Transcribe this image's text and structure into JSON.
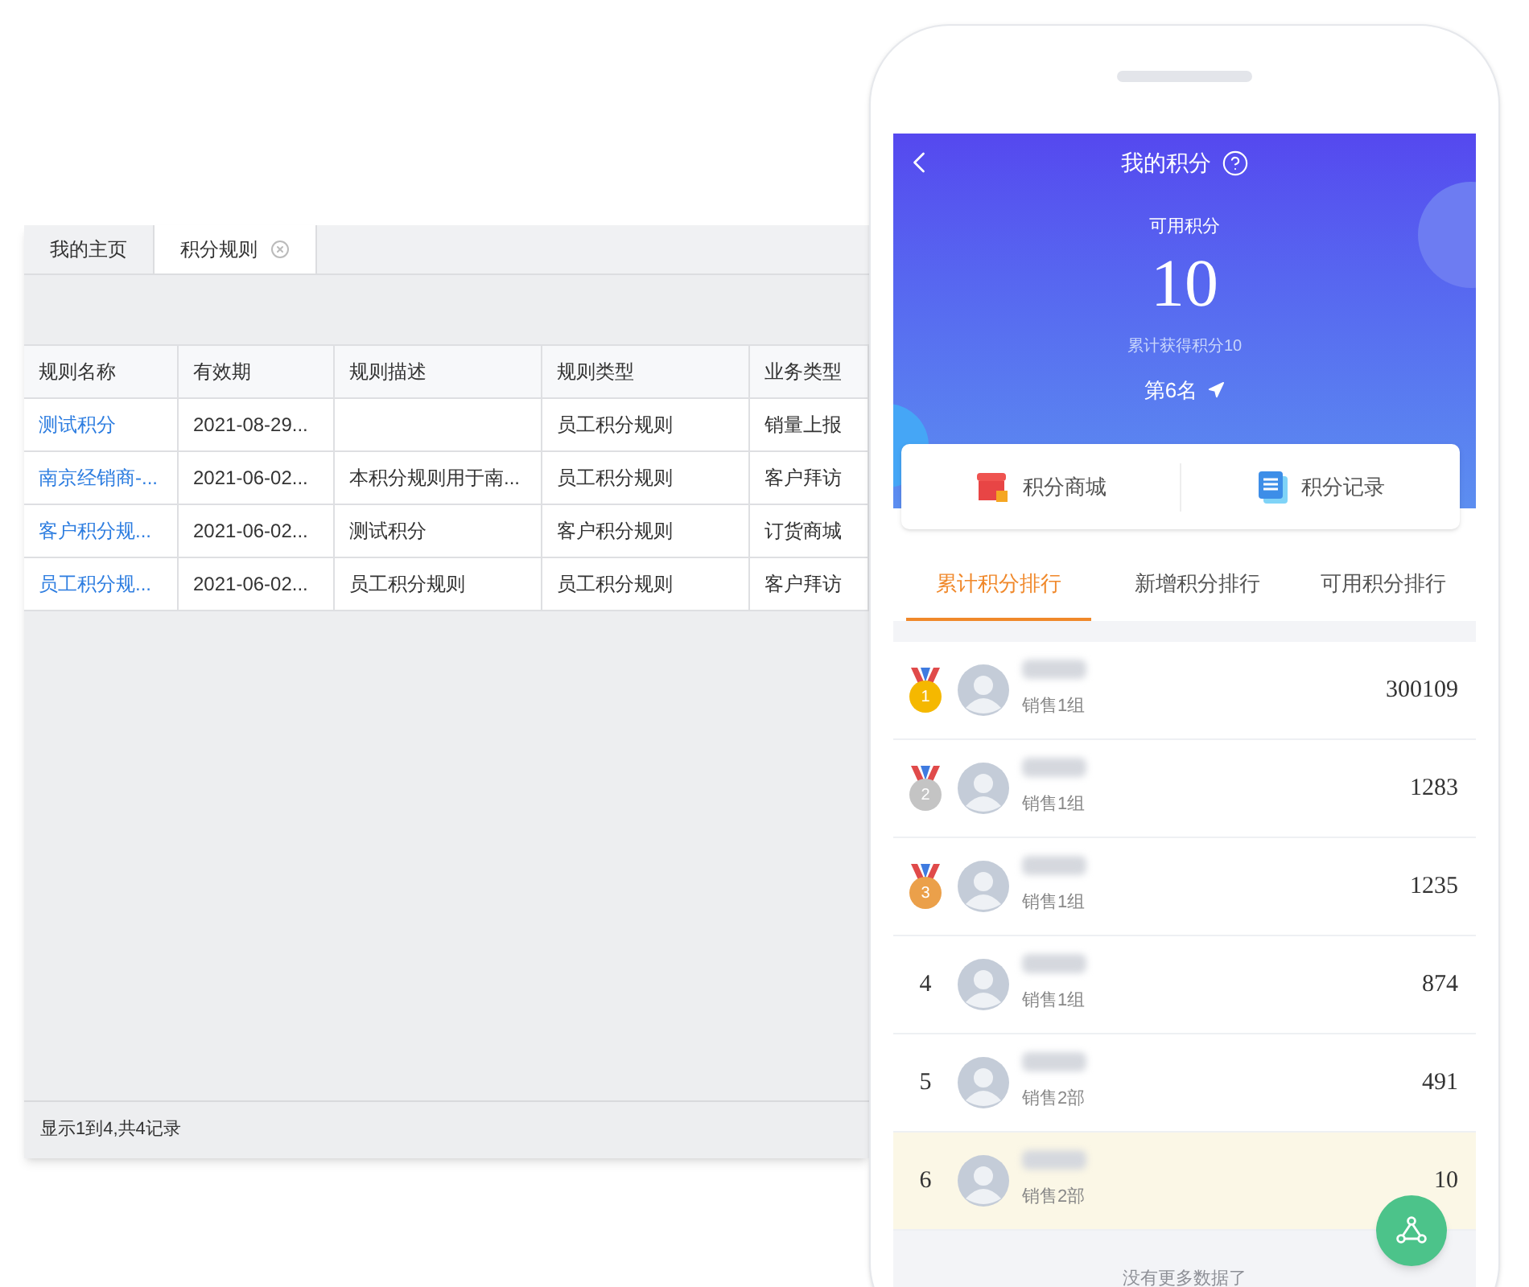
{
  "admin": {
    "tabs": [
      {
        "label": "我的主页",
        "selected": false,
        "closable": false
      },
      {
        "label": "积分规则",
        "selected": true,
        "closable": true
      }
    ],
    "table": {
      "columns": [
        "规则名称",
        "有效期",
        "规则描述",
        "规则类型",
        "业务类型"
      ],
      "rows": [
        [
          "测试积分",
          "2021-08-29...",
          "",
          "员工积分规则",
          "销量上报"
        ],
        [
          "南京经销商-...",
          "2021-06-02...",
          "本积分规则用于南...",
          "员工积分规则",
          "客户拜访"
        ],
        [
          "客户积分规...",
          "2021-06-02...",
          "测试积分",
          "客户积分规则",
          "订货商城"
        ],
        [
          "员工积分规...",
          "2021-06-02...",
          "员工积分规则",
          "员工积分规则",
          "客户拜访"
        ]
      ]
    },
    "footer": "显示1到4,共4记录"
  },
  "phone": {
    "title": "我的积分",
    "available_label": "可用积分",
    "available": "10",
    "total": "累计获得积分10",
    "rank": "第6名",
    "shortcuts": [
      {
        "kind": "store",
        "label": "积分商城"
      },
      {
        "kind": "records",
        "label": "积分记录"
      }
    ],
    "tabs": [
      {
        "label": "累计积分排行",
        "selected": true
      },
      {
        "label": "新增积分排行",
        "selected": false
      },
      {
        "label": "可用积分排行",
        "selected": false
      }
    ],
    "ranking": [
      {
        "kind": "medal",
        "rank": "1",
        "color": "#f5b800",
        "group": "销售1组",
        "points": "300109",
        "current": false
      },
      {
        "kind": "medal",
        "rank": "2",
        "color": "#c4c4c4",
        "group": "销售1组",
        "points": "1283",
        "current": false
      },
      {
        "kind": "medal",
        "rank": "3",
        "color": "#eba04a",
        "group": "销售1组",
        "points": "1235",
        "current": false
      },
      {
        "kind": "plain",
        "rank": "4",
        "group": "销售1组",
        "points": "874",
        "current": false
      },
      {
        "kind": "plain",
        "rank": "5",
        "group": "销售2部",
        "points": "491",
        "current": false
      },
      {
        "kind": "plain",
        "rank": "6",
        "group": "销售2部",
        "points": "10",
        "current": true
      }
    ],
    "end_note": "没有更多数据了"
  }
}
